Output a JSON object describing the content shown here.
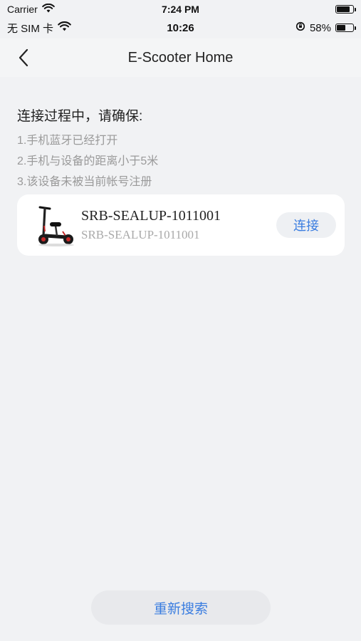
{
  "outer_status": {
    "carrier": "Carrier",
    "time": "7:24 PM",
    "battery_level": 0.85
  },
  "inner_status": {
    "carrier": "无 SIM 卡",
    "time": "10:26",
    "battery_percent": "58%",
    "battery_level": 0.58
  },
  "nav": {
    "title": "E-Scooter Home",
    "back_icon": "chevron-left-icon"
  },
  "tips": {
    "heading": "连接过程中，请确保:",
    "items": [
      "1.手机蓝牙已经打开",
      "2.手机与设备的距离小于5米",
      "3.该设备未被当前帐号注册"
    ]
  },
  "device": {
    "name": "SRB-SEALUP-1011001",
    "subtitle": "SRB-SEALUP-1011001",
    "connect_label": "连接",
    "icon": "e-scooter-icon"
  },
  "research_label": "重新搜索",
  "colors": {
    "accent": "#3a7de0",
    "background": "#f1f2f4",
    "card": "#ffffff"
  }
}
